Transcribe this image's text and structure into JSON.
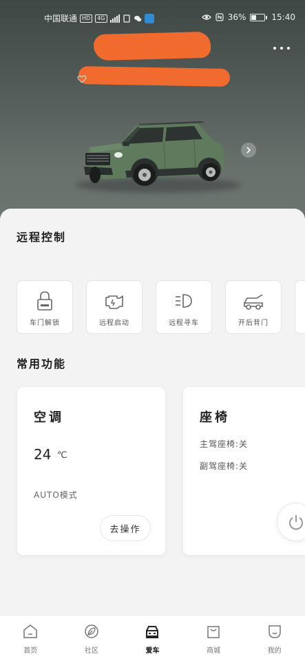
{
  "status_bar": {
    "carrier": "中国联通",
    "network_badges": [
      "HD",
      "4G"
    ],
    "battery": "36%",
    "time": "15:40",
    "battery_level": 0.36
  },
  "header": {
    "more_icon": "more-dots-icon",
    "favorite_icon": "heart-icon",
    "next_icon": "chevron-right-icon"
  },
  "remote_control": {
    "title": "远程控制",
    "items": [
      {
        "label": "车门解锁",
        "icon": "lock-icon"
      },
      {
        "label": "远程启动",
        "icon": "engine-icon"
      },
      {
        "label": "远程寻车",
        "icon": "headlight-icon"
      },
      {
        "label": "开后背门",
        "icon": "car-trunk-icon"
      }
    ]
  },
  "common_functions": {
    "title": "常用功能",
    "ac": {
      "title": "空调",
      "temperature": "24",
      "unit": "℃",
      "mode": "AUTO模式",
      "action_label": "去操作"
    },
    "seat": {
      "title": "座椅",
      "driver_seat": "主驾座椅:关",
      "passenger_seat": "副驾座椅:关",
      "power_icon": "power-icon"
    }
  },
  "bottom_nav": {
    "items": [
      {
        "label": "首页",
        "icon": "home-icon",
        "active": false
      },
      {
        "label": "社区",
        "icon": "leaf-icon",
        "active": false
      },
      {
        "label": "爱车",
        "icon": "car-icon",
        "active": true
      },
      {
        "label": "商城",
        "icon": "shop-icon",
        "active": false
      },
      {
        "label": "我的",
        "icon": "profile-icon",
        "active": false
      }
    ]
  },
  "colors": {
    "redaction": "#f26b2e",
    "hero_bg": "#565f5b",
    "car_body": "#5f7a5c"
  }
}
